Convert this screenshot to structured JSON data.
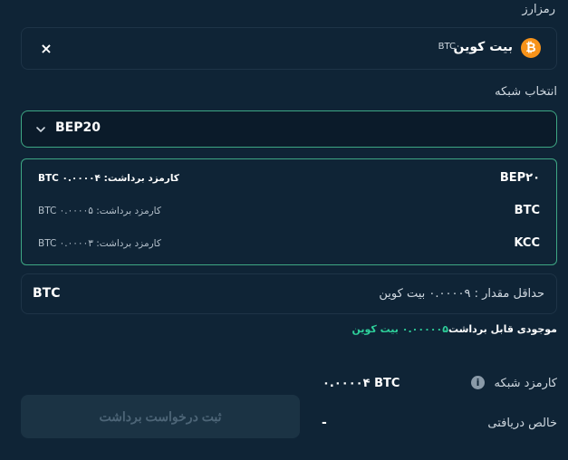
{
  "crypto": {
    "label": "رمزارز",
    "selected_name": "بیت کوین",
    "selected_symbol": "BTC",
    "logo_glyph": "₿",
    "clear_glyph": "×"
  },
  "network": {
    "label": "انتخاب شبکه",
    "selected": "BEP20",
    "options": [
      {
        "name": "BEP۲۰",
        "fee": "کارمزد برداشت: BTC ۰.۰۰۰۰۴"
      },
      {
        "name": "BTC",
        "fee": "کارمزد برداشت: BTC ۰.۰۰۰۰۵"
      },
      {
        "name": "KCC",
        "fee": "کارمزد برداشت: BTC ۰.۰۰۰۰۳"
      }
    ]
  },
  "amount": {
    "unit": "BTC",
    "minimum": "حداقل مقدار : ۰.۰۰۰۰۹ بیت کوین"
  },
  "balance": {
    "label": "موجودی قابل برداشت",
    "value": "۰.۰۰۰۰۰۵ بیت کوین"
  },
  "summary": {
    "fee_label": "کارمزد شبکه",
    "fee_value": "۰.۰۰۰۰۴ BTC",
    "net_label": "خالص دریافتی",
    "net_value": "-"
  },
  "submit": {
    "label": "ثبت درخواست برداشت"
  },
  "colors": {
    "background": "#0f2436",
    "accent": "#3ea784",
    "balance_value": "#2ecf9a",
    "btc_orange": "#f7931a",
    "disabled_button": "#1b3344"
  },
  "icons": {
    "logo": "bitcoin-icon",
    "clear": "close-icon",
    "dropdown": "chevron-down-icon",
    "info": "info-icon"
  }
}
